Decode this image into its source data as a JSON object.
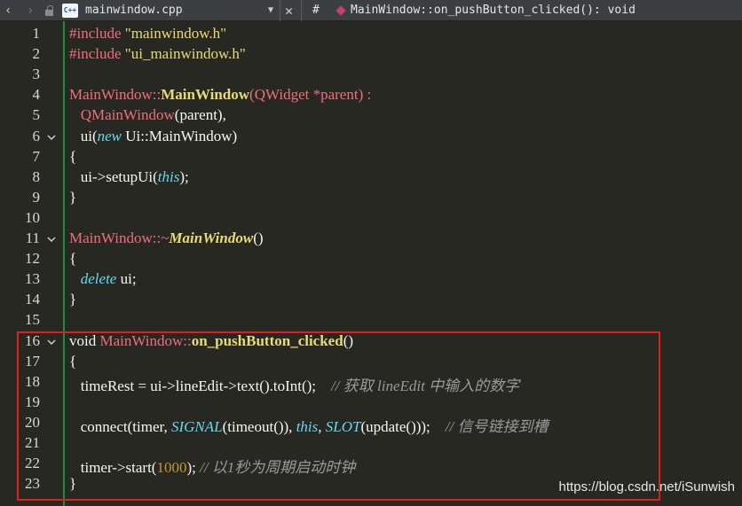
{
  "toolbar": {
    "back_icon": "‹",
    "forward_icon": "›",
    "filename": "mainwindow.cpp",
    "file_dropdown_icon": "▼",
    "close_icon": "✕",
    "hash": "#",
    "function_signature": "MainWindow::on_pushButton_clicked(): void",
    "cpp_icon_text": "C++"
  },
  "line_numbers": [
    "1",
    "2",
    "3",
    "4",
    "5",
    "6",
    "7",
    "8",
    "9",
    "10",
    "11",
    "12",
    "13",
    "14",
    "15",
    "16",
    "17",
    "18",
    "19",
    "20",
    "21",
    "22",
    "23"
  ],
  "code": {
    "l1": {
      "pp": "#include",
      "str": "\"mainwindow.h\""
    },
    "l2": {
      "pp": "#include",
      "str": "\"ui_mainwindow.h\""
    },
    "l4": {
      "cls": "MainWindow",
      "sep": "::",
      "fn": "MainWindow",
      "p1": "(",
      "ty": "QWidget",
      "rest": " *parent) :"
    },
    "l5": {
      "cls": "QMainWindow",
      "rest": "(parent),"
    },
    "l6": {
      "a": "ui(",
      "kw": "new",
      "b": " Ui::MainWindow)"
    },
    "l7": "{",
    "l8": {
      "a": "ui->setupUi(",
      "kw": "this",
      "b": ");"
    },
    "l9": "}",
    "l11": {
      "cls": "MainWindow",
      "sep": "::~",
      "fn": "MainWindow",
      "rest": "()"
    },
    "l12": "{",
    "l13": {
      "kw": "delete",
      "rest": " ui;"
    },
    "l14": "}",
    "l16": {
      "kw": "void",
      "cls": " MainWindow",
      "sep": "::",
      "fn": "on_pushButton_clicked",
      "rest": "()"
    },
    "l17": "{",
    "l18": {
      "code": "timeRest = ui->lineEdit->text().toInt();",
      "comment": "// 获取 lineEdit 中输入的数字"
    },
    "l20": {
      "a": "connect(timer, ",
      "sig": "SIGNAL",
      "b": "(timeout()), ",
      "this": "this",
      "c": ", ",
      "slot": "SLOT",
      "d": "(update()));",
      "comment": "// 信号链接到槽"
    },
    "l22": {
      "a": "timer->start(",
      "num": "1000",
      "b": ");",
      "comment": " // 以1秒为周期启动时钟"
    },
    "l23": "}"
  },
  "watermark": "https://blog.csdn.net/iSunwish",
  "colors": {
    "background": "#272822",
    "toolbar": "#3c3f41",
    "highlight_box": "#e02020",
    "class_name": "#f06d7e",
    "keyword_italic": "#66d9ef",
    "string": "#e6db74",
    "comment": "#9a9a9a",
    "gutter_marker": "#1e8c3c"
  }
}
